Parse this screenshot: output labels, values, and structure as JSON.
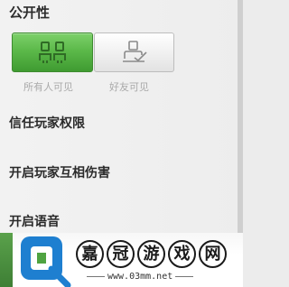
{
  "visibility": {
    "title": "公开性",
    "options": [
      {
        "label": "所有人可见",
        "icon": "two-people-icon",
        "selected": true
      },
      {
        "label": "好友可见",
        "icon": "friend-with-check-icon",
        "selected": false
      }
    ]
  },
  "settings": [
    {
      "label": "信任玩家权限"
    },
    {
      "label": "开启玩家互相伤害"
    },
    {
      "label": "开启语音"
    }
  ],
  "watermark": {
    "characters": [
      "嘉",
      "冠",
      "游",
      "戏",
      "网"
    ],
    "url": "www.03mm.net",
    "logo_icon": "site-logo-icon"
  },
  "colors": {
    "selected_button": "#5cb94a",
    "unselected_button": "#f1f1f1",
    "caption_text": "#a9a9a9",
    "logo_blue": "#1e7fd0",
    "logo_green": "#4fa341"
  }
}
